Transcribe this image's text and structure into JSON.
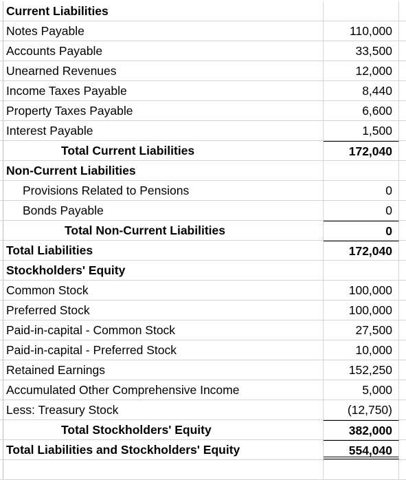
{
  "rows": [
    {
      "label": "Current Liabilities",
      "value": "",
      "style": "header"
    },
    {
      "label": "Notes Payable",
      "value": "110,000"
    },
    {
      "label": "Accounts Payable",
      "value": "33,500"
    },
    {
      "label": "Unearned Revenues",
      "value": "12,000"
    },
    {
      "label": "Income Taxes Payable",
      "value": "8,440"
    },
    {
      "label": "Property Taxes Payable",
      "value": "6,600"
    },
    {
      "label": "Interest Payable",
      "value": "1,500"
    },
    {
      "label": "Total Current Liabilities",
      "value": "172,040",
      "style": "total"
    },
    {
      "label": "Non-Current Liabilities",
      "value": "",
      "style": "header"
    },
    {
      "label": "Provisions Related to Pensions",
      "value": "0",
      "style": "indent"
    },
    {
      "label": "Bonds Payable",
      "value": "0",
      "style": "indent"
    },
    {
      "label": "Total Non-Current Liabilities",
      "value": "0",
      "style": "total"
    },
    {
      "label": "Total Liabilities",
      "value": "172,040",
      "style": "grand"
    },
    {
      "label": "Stockholders' Equity",
      "value": "",
      "style": "header"
    },
    {
      "label": "Common Stock",
      "value": "100,000"
    },
    {
      "label": "Preferred Stock",
      "value": "100,000"
    },
    {
      "label": "Paid-in-capital - Common Stock",
      "value": "27,500"
    },
    {
      "label": "Paid-in-capital - Preferred Stock",
      "value": "10,000"
    },
    {
      "label": "Retained Earnings",
      "value": "152,250"
    },
    {
      "label": "Accumulated Other Comprehensive Income",
      "value": "5,000"
    },
    {
      "label": "Less: Treasury Stock",
      "value": "(12,750)"
    },
    {
      "label": "Total Stockholders' Equity",
      "value": "382,000",
      "style": "total"
    },
    {
      "label": "Total Liabilities and Stockholders' Equity",
      "value": "554,040",
      "style": "grand"
    }
  ]
}
